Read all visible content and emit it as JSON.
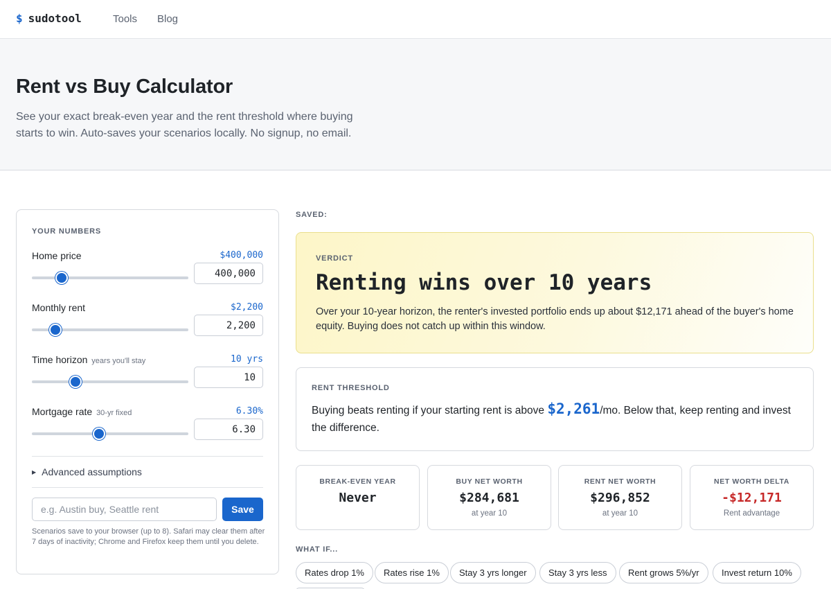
{
  "header": {
    "logo_symbol": "$",
    "logo_text": "sudotool",
    "nav": [
      "Tools",
      "Blog"
    ]
  },
  "hero": {
    "title": "Rent vs Buy Calculator",
    "subtitle": "See your exact break-even year and the rent threshold where buying starts to win. Auto-saves your scenarios locally. No signup, no email."
  },
  "inputs": {
    "section_label": "YOUR NUMBERS",
    "fields": [
      {
        "label": "Home price",
        "hint": "",
        "display": "$400,000",
        "value": "400,000",
        "slider_fraction": 0.19
      },
      {
        "label": "Monthly rent",
        "hint": "",
        "display": "$2,200",
        "value": "2,200",
        "slider_fraction": 0.15
      },
      {
        "label": "Time horizon",
        "hint": "years you'll stay",
        "display": "10 yrs",
        "value": "10",
        "slider_fraction": 0.28
      },
      {
        "label": "Mortgage rate",
        "hint": "30-yr fixed",
        "display": "6.30%",
        "value": "6.30",
        "slider_fraction": 0.43
      }
    ],
    "advanced_label": "Advanced assumptions",
    "scenario_placeholder": "e.g. Austin buy, Seattle rent",
    "save_label": "Save",
    "note": "Scenarios save to your browser (up to 8). Safari may clear them after 7 days of inactivity; Chrome and Firefox keep them until you delete."
  },
  "saved_label": "SAVED:",
  "verdict": {
    "label": "VERDICT",
    "title": "Renting wins over 10 years",
    "body": "Over your 10-year horizon, the renter's invested portfolio ends up about $12,171 ahead of the buyer's home equity. Buying does not catch up within this window."
  },
  "threshold": {
    "label": "RENT THRESHOLD",
    "text_before": "Buying beats renting if your starting rent is above ",
    "amount": "$2,261",
    "text_after": "/mo. Below that, keep renting and invest the difference."
  },
  "stats": [
    {
      "label": "BREAK-EVEN YEAR",
      "value": "Never",
      "sub": "",
      "color": "#1f2328"
    },
    {
      "label": "BUY NET WORTH",
      "value": "$284,681",
      "sub": "at year 10",
      "color": "#1f2328"
    },
    {
      "label": "RENT NET WORTH",
      "value": "$296,852",
      "sub": "at year 10",
      "color": "#1f2328"
    },
    {
      "label": "NET WORTH DELTA",
      "value": "-$12,171",
      "sub": "Rent advantage",
      "color": "#c62828"
    }
  ],
  "whatif": {
    "label": "WHAT IF...",
    "chips": [
      "Rates drop 1%",
      "Rates rise 1%",
      "Stay 3 yrs longer",
      "Stay 3 yrs less",
      "Rent grows 5%/yr",
      "Invest return 10%"
    ]
  },
  "colors": {
    "accent": "#1a66cc",
    "negative": "#c62828",
    "verdict_bg": "#fdf6c8"
  }
}
